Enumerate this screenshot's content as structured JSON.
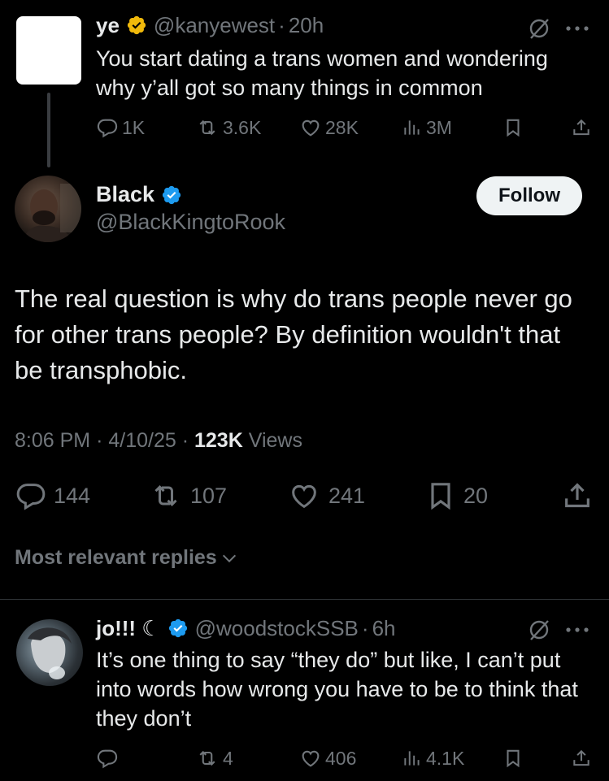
{
  "parent": {
    "name": "ye",
    "handle": "@kanyewest",
    "separator": "·",
    "time": "20h",
    "text": "You start dating a trans women and wondering why y’all got so many things in common",
    "replies": "1K",
    "reposts": "3.6K",
    "likes": "28K",
    "views": "3M",
    "badge_color": "#f0b90b"
  },
  "main": {
    "name": "Black",
    "handle": "@BlackKingtoRook",
    "follow_label": "Follow",
    "text": "The real question is why do trans people never go for other trans people? By definition wouldn't that be transphobic.",
    "time": "8:06 PM",
    "separator": "·",
    "date": "4/10/25",
    "views_count": "123K",
    "views_label": "Views",
    "replies": "144",
    "reposts": "107",
    "likes": "241",
    "bookmarks": "20",
    "badge_color": "#1d9bf0"
  },
  "sort": {
    "label": "Most relevant replies"
  },
  "reply": {
    "name": "jo!!! ☾",
    "handle": "@woodstockSSB",
    "separator": "·",
    "time": "6h",
    "text": "It’s one thing to say “they do” but like, I can’t put into words how wrong you have to be to think that they don’t",
    "reposts": "4",
    "likes": "406",
    "views": "4.1K",
    "badge_color": "#1d9bf0"
  },
  "icons": {
    "reply": "reply-icon",
    "repost": "repost-icon",
    "like": "heart-icon",
    "views": "views-icon",
    "bookmark": "bookmark-icon",
    "share": "share-icon",
    "grok": "grok-icon",
    "more": "more-icon"
  }
}
